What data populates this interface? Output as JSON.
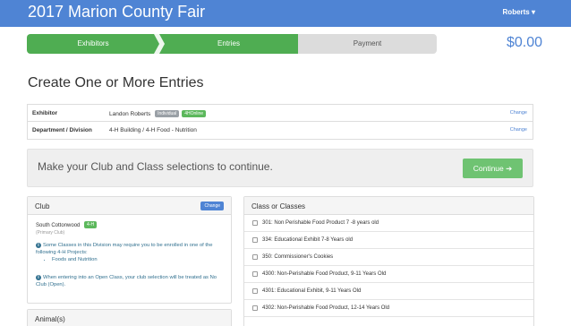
{
  "header": {
    "title": "2017 Marion County Fair",
    "user": "Roberts ▾"
  },
  "stepper": {
    "steps": [
      "Exhibitors",
      "Entries",
      "Payment"
    ],
    "total": "$0.00"
  },
  "page_title": "Create One or More Entries",
  "info": {
    "exhibitor_label": "Exhibitor",
    "exhibitor_name": "Landon Roberts",
    "badge_individual": "Individual",
    "badge_4h": "4HOnline",
    "dept_label": "Department / Division",
    "dept_value": "4-H Building  /  4-H Food - Nutrition",
    "change_label": "Change"
  },
  "alert": {
    "message": "Make your Club and Class selections to continue.",
    "continue_label": "Continue ➔"
  },
  "club": {
    "header": "Club",
    "change_label": "Change",
    "name": "South Cottonwood",
    "badge": "4-H",
    "sub": "(Primary Club)",
    "note1": "Some Classes in this Division may require you to be enrolled in one of the following 4-H Projects:",
    "project": "Foods and Nutrition",
    "note2": "When entering into an Open Class, your club selection will be treated as No Club (Open)."
  },
  "animals": {
    "header": "Animal(s)"
  },
  "classes": {
    "header": "Class or Classes",
    "items": [
      "301: Non Perishable Food Product 7 -8 years old",
      "334: Educational Exhibit 7-8 Years old",
      "350: Commissioner's Cookies",
      "4300: Non-Perishable Food Product, 9-11 Years Old",
      "4301: Educational Exhibit, 9-11 Years Old",
      "4302: Non-Perishable Food Product, 12-14 Years Old"
    ]
  },
  "colors": {
    "brand_blue": "#4f84d4",
    "step_green": "#4fad52",
    "continue_green": "#6fc372"
  }
}
